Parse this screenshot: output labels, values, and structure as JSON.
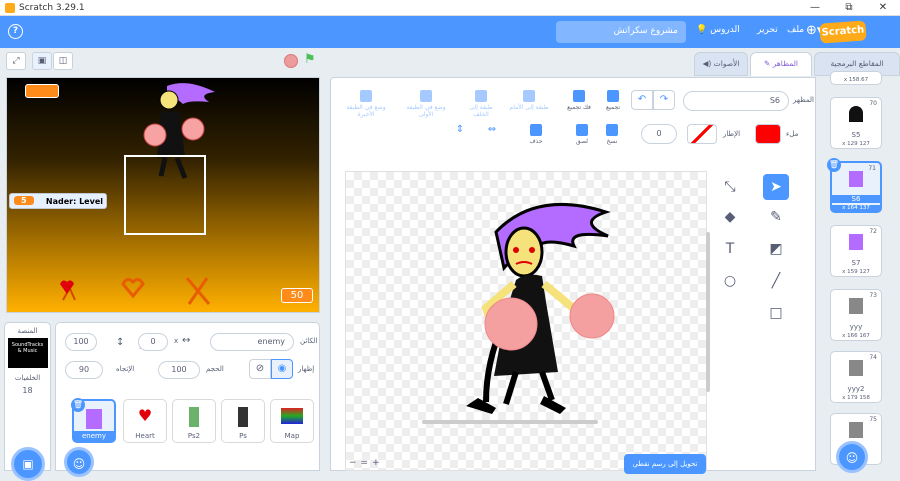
{
  "window": {
    "title": "Scratch 3.29.1",
    "minimize": "—",
    "restore": "⧉",
    "close": "✕"
  },
  "menu": {
    "help": "?",
    "project_title": "مشروع سكراتش",
    "tutorials": "الدروس",
    "edit": "تحرير",
    "file": "ملف",
    "logo": "Scratch"
  },
  "stage": {
    "level_label": "Nader: Level",
    "level_value": "5",
    "score_value": "50"
  },
  "tabs": {
    "costumes": "المظاهر",
    "sounds": "الأصوات",
    "code": "المقاطع البرمجية"
  },
  "paint": {
    "costume_label": "المظهر",
    "costume_name": "S6",
    "fill_label": "ملء",
    "outline_label": "الإطار",
    "outline_value": "0",
    "convert_label": "تحويل إلى رسم نقطي",
    "zoom_in": "+",
    "zoom_reset": "=",
    "zoom_out": "−",
    "toolbar": [
      {
        "label": "تجميع",
        "active": false
      },
      {
        "label": "فك تجميع",
        "active": false
      },
      {
        "label": "طبقة إلى الأمام",
        "active": false
      },
      {
        "label": "طبقة إلى الخلف",
        "active": false
      },
      {
        "label": "وضع في الطبقة الأولى",
        "active": false
      },
      {
        "label": "وضع في الطبقة الأخيرة",
        "active": false
      }
    ],
    "toolbar2": [
      {
        "label": "حذف"
      },
      {
        "label": "نسخ"
      },
      {
        "label": "لصق"
      }
    ]
  },
  "sprite": {
    "name_label": "الكائن",
    "name": "enemy",
    "x_label": "x",
    "x": "0",
    "y_label": "y",
    "y": "100",
    "show_label": "إظهار",
    "size_label": "الحجم",
    "size": "100",
    "direction_label": "الإتجاه",
    "direction": "90"
  },
  "stage_pane": {
    "label": "المنصة",
    "backdrops_label": "الخلفيات",
    "backdrops_count": "18",
    "thumb_line1": "SoundTracks",
    "thumb_line2": "& Music"
  },
  "sprites": [
    {
      "name": "enemy"
    },
    {
      "name": "Heart"
    },
    {
      "name": "Ps2"
    },
    {
      "name": "Ps"
    },
    {
      "name": "Map"
    }
  ],
  "costumes": [
    {
      "num": "",
      "name": "",
      "size": "x 158.67"
    },
    {
      "num": "70",
      "name": "S5",
      "size": "x 129 127"
    },
    {
      "num": "71",
      "name": "S6",
      "size": "x 164 137"
    },
    {
      "num": "72",
      "name": "S7",
      "size": "x 159 127"
    },
    {
      "num": "73",
      "name": "yyy",
      "size": "x 166 167"
    },
    {
      "num": "74",
      "name": "yyy2",
      "size": "x 179 158"
    },
    {
      "num": "75",
      "name": "",
      "size": ""
    }
  ],
  "colors": {
    "accent": "#4c97ff",
    "fill": "#ff0000",
    "monitor": "#ff8c1a"
  }
}
